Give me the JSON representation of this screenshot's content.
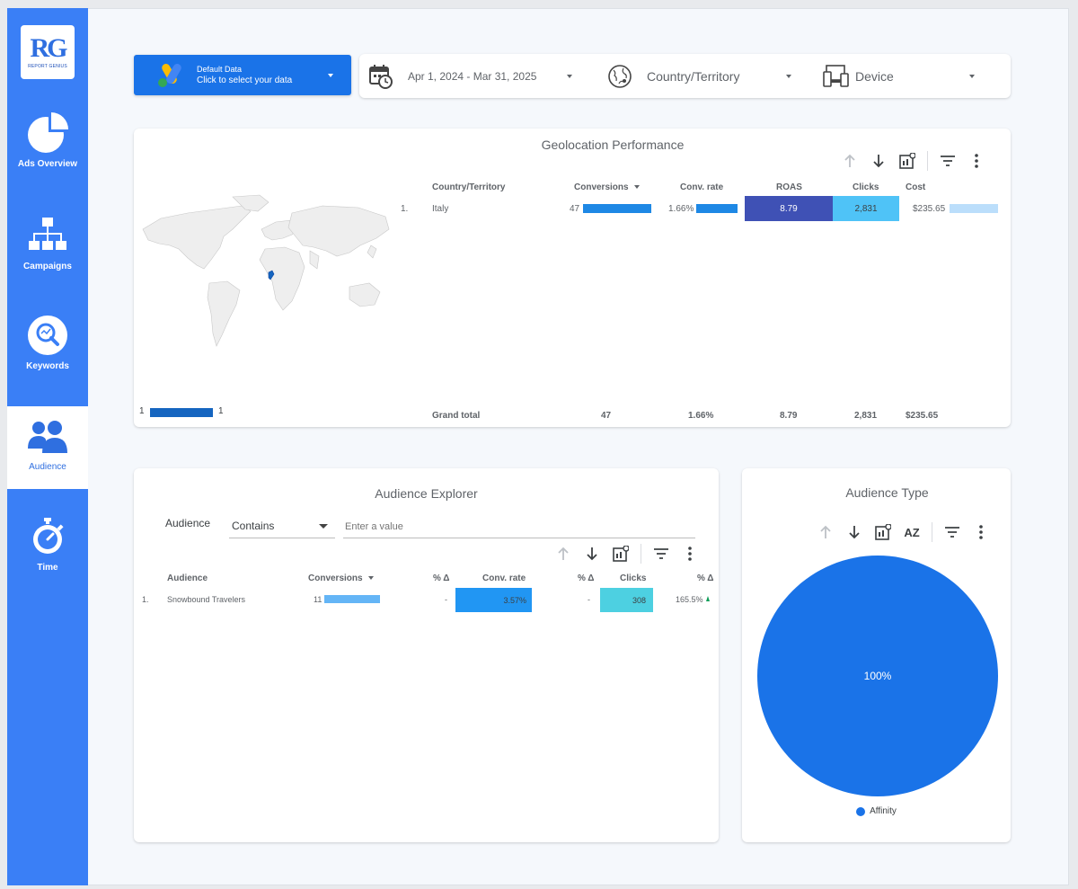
{
  "logo": {
    "mark_r": "R",
    "mark_g": "G",
    "subtitle": "REPORT GENIUS"
  },
  "nav": [
    {
      "label": "Ads Overview",
      "icon": "pie-chart-icon"
    },
    {
      "label": "Campaigns",
      "icon": "hierarchy-icon"
    },
    {
      "label": "Keywords",
      "icon": "magnifier-icon"
    },
    {
      "label": "Audience",
      "icon": "people-icon",
      "active": true
    },
    {
      "label": "Time",
      "icon": "stopwatch-icon"
    }
  ],
  "topbar": {
    "data_title": "Default Data",
    "data_subtitle": "Click to select your data",
    "date_range": "Apr 1, 2024 - Mar 31, 2025",
    "country_filter": "Country/Territory",
    "device_filter": "Device"
  },
  "geo": {
    "title": "Geolocation Performance",
    "legend_min": "1",
    "legend_max": "1",
    "headers": [
      "Country/Territory",
      "Conversions",
      "Conv. rate",
      "ROAS",
      "Clicks",
      "Cost"
    ],
    "rows": [
      {
        "rank": "1.",
        "country": "Italy",
        "conversions": "47",
        "conv_rate": "1.66%",
        "roas": "8.79",
        "clicks": "2,831",
        "cost": "$235.65"
      }
    ],
    "total": {
      "label": "Grand total",
      "conversions": "47",
      "conv_rate": "1.66%",
      "roas": "8.79",
      "clicks": "2,831",
      "cost": "$235.65"
    }
  },
  "explorer": {
    "title": "Audience Explorer",
    "filter_label": "Audience",
    "filter_op": "Contains",
    "filter_placeholder": "Enter a value",
    "headers": [
      "Audience",
      "Conversions",
      "% Δ",
      "Conv. rate",
      "% Δ",
      "Clicks",
      "% Δ"
    ],
    "rows": [
      {
        "rank": "1.",
        "audience": "Snowbound Travelers",
        "conversions": "11",
        "conv_delta": "-",
        "conv_rate": "3.57%",
        "rate_delta": "-",
        "clicks": "308",
        "clicks_delta": "165.5%"
      }
    ]
  },
  "audience_type": {
    "title": "Audience Type",
    "az_label": "AZ",
    "pie_label": "100%",
    "legend": "Affinity"
  },
  "chart_data": {
    "type": "pie",
    "title": "Audience Type",
    "categories": [
      "Affinity"
    ],
    "values": [
      100
    ],
    "colors": [
      "#1a73e8"
    ],
    "legend_position": "bottom"
  },
  "colors": {
    "sidebar": "#3a7ff6",
    "primary": "#1a73e8",
    "roas_cell": "#3f51b5",
    "clicks_cell": "#4fc3f7",
    "cost_bar": "#bbdefb",
    "explorer_conv_bar": "#64b5f6",
    "explorer_rate_cell": "#2196f3",
    "explorer_clicks_cell": "#4dd0e1",
    "italy": "#1565c0"
  }
}
